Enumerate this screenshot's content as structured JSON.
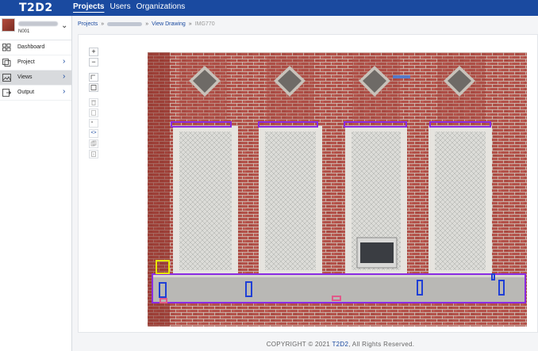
{
  "app": {
    "logo": "T2D2"
  },
  "topnav": {
    "projects": "Projects",
    "users": "Users",
    "organizations": "Organizations"
  },
  "sidebar": {
    "user_code": "N001",
    "items": [
      {
        "label": "Dashboard",
        "icon": "grid-icon"
      },
      {
        "label": "Project",
        "icon": "layers-icon"
      },
      {
        "label": "Views",
        "icon": "image-icon"
      },
      {
        "label": "Output",
        "icon": "output-icon"
      }
    ]
  },
  "breadcrumb": {
    "projects": "Projects",
    "separator": "»",
    "view_drawing": "View Drawing",
    "current": "IMG770"
  },
  "footer": {
    "prefix": "COPYRIGHT © 2021 ",
    "brand": "T2D2",
    "suffix": ", All Rights Reserved."
  },
  "colors": {
    "topbar": "#1a4aa0",
    "annotation_purple": "#8a2be2",
    "annotation_blue": "#1f3fd6",
    "annotation_yellow": "#e6e600",
    "annotation_pink": "#e05a8a"
  }
}
